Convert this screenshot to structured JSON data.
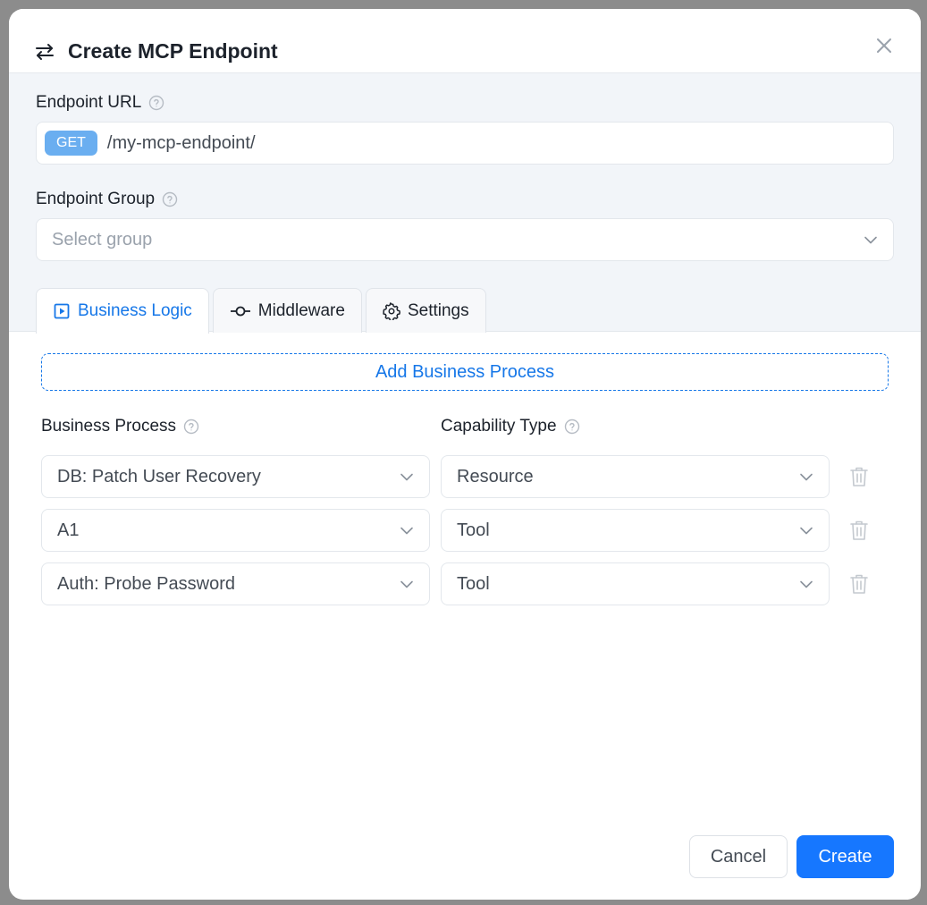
{
  "modal": {
    "title": "Create MCP Endpoint",
    "header_icon": "arrows-swap-icon",
    "close_icon": "close-icon"
  },
  "endpoint_url": {
    "label": "Endpoint URL",
    "method": "GET",
    "value": "/my-mcp-endpoint/"
  },
  "endpoint_group": {
    "label": "Endpoint Group",
    "placeholder": "Select group"
  },
  "tabs": [
    {
      "label": "Business Logic",
      "icon": "play-square-icon",
      "active": true
    },
    {
      "label": "Middleware",
      "icon": "commit-node-icon",
      "active": false
    },
    {
      "label": "Settings",
      "icon": "gear-icon",
      "active": false
    }
  ],
  "business_logic": {
    "add_label": "Add Business Process",
    "columns": {
      "process": "Business Process",
      "capability": "Capability Type"
    },
    "rows": [
      {
        "process": "DB: Patch User Recovery",
        "capability": "Resource"
      },
      {
        "process": "A1",
        "capability": "Tool"
      },
      {
        "process": "Auth: Probe Password",
        "capability": "Tool"
      }
    ]
  },
  "footer": {
    "cancel_label": "Cancel",
    "create_label": "Create"
  },
  "colors": {
    "primary": "#1677ff",
    "badge": "#6aaef0",
    "section_bg": "#f2f5f9"
  }
}
